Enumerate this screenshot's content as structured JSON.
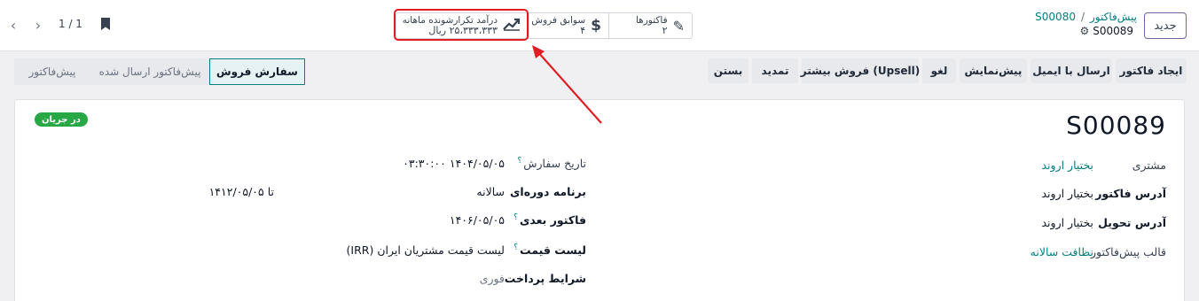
{
  "topbar": {
    "new_button": "جدید",
    "breadcrumb_parent": "پیش‌فاکتور",
    "breadcrumb_sep": "/",
    "breadcrumb_current": "S00080",
    "record_name": "S00089",
    "pager": "1 / 1"
  },
  "smart_buttons": {
    "invoices_label": "فاکتورها",
    "invoices_value": "۲",
    "sales_label": "سوابق فروش",
    "sales_value": "۴",
    "mrr_label": "درآمد تکرارشونده ماهانه",
    "mrr_value": "۲۵،۳۳۳،۳۳۳ ریال"
  },
  "actions": {
    "create_invoice": "ایجاد فاکتور",
    "send_email": "ارسال با ایمیل",
    "preview": "پیش‌نمایش",
    "cancel": "لغو",
    "upsell": "فروش بیشتر (Upsell)",
    "renew": "تمدید",
    "close": "بستن"
  },
  "status_stages": [
    "سفارش فروش",
    "پیش‌فاکتور ارسال شده",
    "پیش‌فاکتور"
  ],
  "form": {
    "badge": "در جریان",
    "title": "S00089",
    "customer_label": "مشتری",
    "customer_value": "بختیار اروند",
    "invoice_address_label": "آدرس فاکتور",
    "invoice_address_value": "بختیار اروند",
    "delivery_address_label": "آدرس تحویل",
    "delivery_address_value": "بختیار اروند",
    "template_label": "قالب پیش‌فاکتور",
    "template_value": "نظافت سالانه",
    "order_date_label": "تاریخ سفارش",
    "order_date_value": "۱۴۰۴/۰۵/۰۵ ۰۳:۳۰:۰۰",
    "recurring_plan_label": "برنامه دوره‌ای",
    "recurring_plan_value": "سالانه",
    "recurring_until": "تا ۱۴۱۲/۰۵/۰۵",
    "next_invoice_label": "فاکتور بعدی",
    "next_invoice_value": "۱۴۰۶/۰۵/۰۵",
    "pricelist_label": "لیست قیمت",
    "pricelist_value": "لیست قیمت مشتریان ایران (IRR)",
    "payment_terms_label": "شرایط پرداخت",
    "payment_terms_value": "فوری",
    "help_mark": "؟"
  },
  "colors": {
    "brand": "#71639e",
    "link": "#017e84",
    "highlight": "#e11d24",
    "badge": "#28a745"
  }
}
